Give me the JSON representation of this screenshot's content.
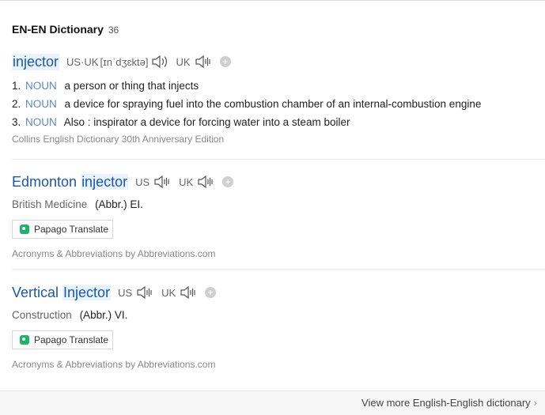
{
  "header": {
    "title": "EN-EN Dictionary",
    "count": "36"
  },
  "entries": [
    {
      "word": "injector",
      "pron": {
        "us_uk_label": "US·UK",
        "ipa": "[ɪnˈdʒɛktə]",
        "uk_label": "UK"
      },
      "meanings": [
        {
          "num": "1.",
          "pos": "NOUN",
          "text": "a person or thing that injects"
        },
        {
          "num": "2.",
          "pos": "NOUN",
          "text": "a device for spraying fuel into the combustion chamber of an internal-combustion engine"
        },
        {
          "num": "3.",
          "pos": "NOUN",
          "text": "Also : inspirator a device for forcing water into a steam boiler"
        }
      ],
      "source": "Collins English Dictionary 30th Anniversary Edition"
    },
    {
      "word_prefix": "Edmonton ",
      "word_highlight": "injector",
      "us_label": "US",
      "uk_label": "UK",
      "field": "British Medicine",
      "abbr": "(Abbr.) EI.",
      "papago": "Papago Translate",
      "source": "Acronyms & Abbreviations by Abbreviations.com"
    },
    {
      "word_prefix": "Vertical ",
      "word_highlight": "Injector",
      "us_label": "US",
      "uk_label": "UK",
      "field": "Construction",
      "abbr": "(Abbr.) VI.",
      "papago": "Papago Translate",
      "source": "Acronyms & Abbreviations by Abbreviations.com"
    }
  ],
  "footer": {
    "more": "View more English-English dictionary",
    "chevron": "›"
  },
  "icons": {
    "speaker": "speaker-icon",
    "add": "add-icon",
    "papago": "papago-icon"
  },
  "colors": {
    "word": "#1a56b3",
    "pos": "#5a86c5",
    "highlight": "#e8f3fc",
    "papago": "#1fb26b"
  }
}
